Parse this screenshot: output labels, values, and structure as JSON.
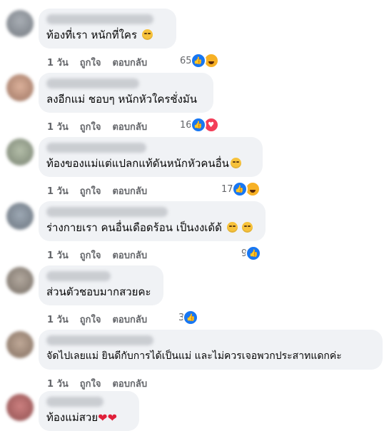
{
  "comments": [
    {
      "text": "ท้องที่เรา หนักที่ใคร",
      "emoji": "smile",
      "time": "1 วัน",
      "like": "ถูกใจ",
      "reply": "ตอบกลับ",
      "count": "65",
      "reacts": [
        "like",
        "haha"
      ]
    },
    {
      "text": "ลงอีกแม่ ชอบๆ หนักหัวใครชั่งมัน",
      "emoji": "",
      "time": "1 วัน",
      "like": "ถูกใจ",
      "reply": "ตอบกลับ",
      "count": "16",
      "reacts": [
        "like",
        "love"
      ]
    },
    {
      "text": "ท้องของแม่แต่แปลกแท้ดันหนักหัวคนอื่น",
      "emoji": "smile",
      "time": "1 วัน",
      "like": "ถูกใจ",
      "reply": "ตอบกลับ",
      "count": "17",
      "reacts": [
        "like",
        "haha"
      ]
    },
    {
      "text": "ร่างกายเรา คนอื่นเดือดร้อน เป็นงงเด้ด้",
      "emoji": "smile2",
      "time": "1 วัน",
      "like": "ถูกใจ",
      "reply": "ตอบกลับ",
      "count": "9",
      "reacts": [
        "like"
      ]
    },
    {
      "text": "ส่วนตัวชอบมากสวยคะ",
      "emoji": "",
      "time": "1 วัน",
      "like": "ถูกใจ",
      "reply": "ตอบกลับ",
      "count": "3",
      "reacts": [
        "like"
      ]
    },
    {
      "text": "จัดไปเลยแม่ ยินดีกับการได้เป็นแม่ และไม่ควรเจอพวกประสาทแดกค่ะ",
      "emoji": "",
      "time": "1 วัน",
      "like": "ถูกใจ",
      "reply": "ตอบกลับ",
      "count": "",
      "reacts": []
    },
    {
      "text": "ท้องแม่สวย",
      "emoji": "hearts",
      "time": "",
      "like": "",
      "reply": "",
      "count": "",
      "reacts": []
    }
  ],
  "colors": {
    "bubble": "#f0f2f5",
    "like": "#1877f2",
    "haha": "#f7b125",
    "love": "#f33e58",
    "meta": "#65676b"
  }
}
